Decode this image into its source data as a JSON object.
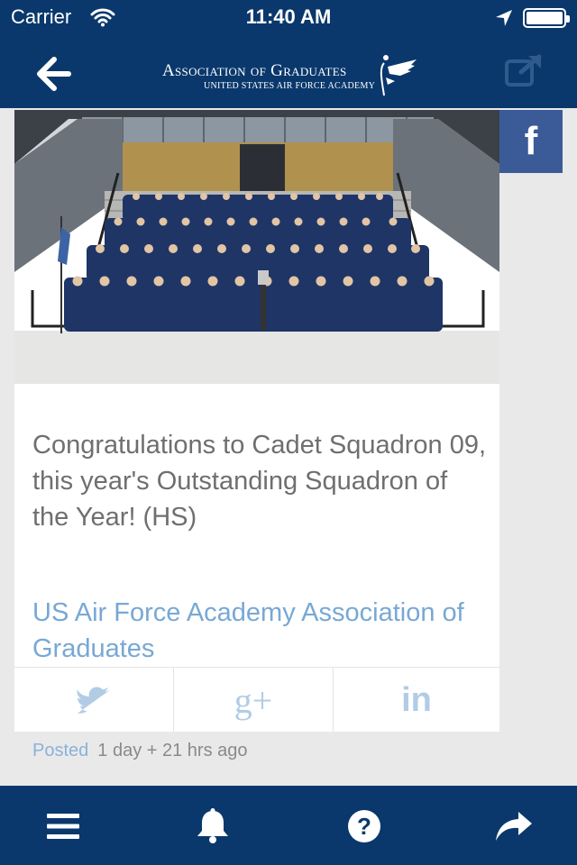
{
  "status_bar": {
    "carrier": "Carrier",
    "time": "11:40 AM"
  },
  "header": {
    "logo_line1": "Association of Graduates",
    "logo_line2": "UNITED STATES AIR FORCE ACADEMY",
    "back_icon": "arrow-left-icon",
    "external_icon": "external-link-icon"
  },
  "post": {
    "text": "Congratulations to Cadet Squadron 09, this year's Outstanding Squadron of the Year! (HS)",
    "source": "US Air Force Academy Association of Graduates",
    "posted_label": "Posted",
    "posted_ago": "1 day + 21 hrs ago",
    "facebook_glyph": "f"
  },
  "share": {
    "icons": [
      "twitter-icon",
      "google-plus-icon",
      "linkedin-icon"
    ],
    "google_glyph": "g+",
    "linkedin_glyph": "in"
  },
  "tabbar": {
    "icons": [
      "menu-icon",
      "bell-icon",
      "help-icon",
      "share-icon"
    ],
    "help_glyph": "?"
  },
  "colors": {
    "brand_navy": "#0a386c",
    "facebook": "#3b5a98",
    "link_blue": "#78a8d4",
    "share_icon": "#b2cce6"
  }
}
